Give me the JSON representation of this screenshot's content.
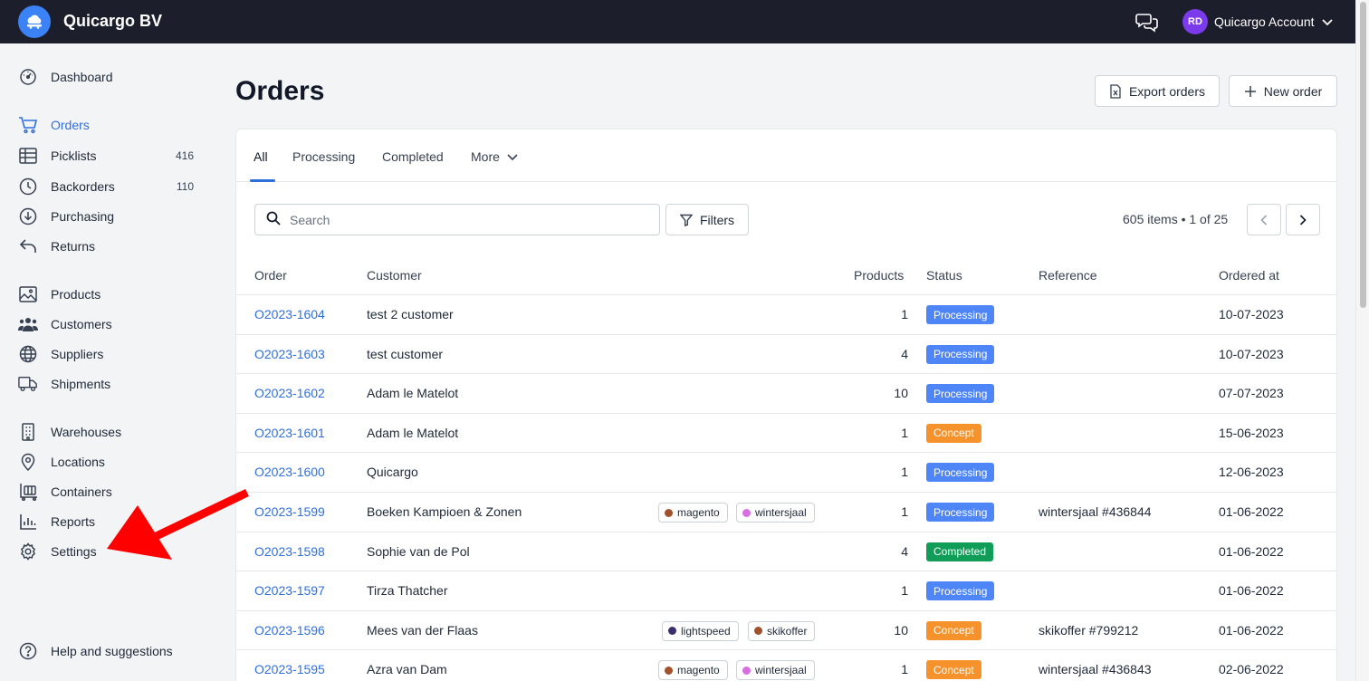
{
  "header": {
    "brand": "Quicargo BV",
    "account_initials": "RD",
    "account_name": "Quicargo Account",
    "colors": {
      "topbar": "#1c1f2b",
      "accent": "#2f6fdc",
      "avatar": "#7c3aed"
    }
  },
  "sidebar": {
    "items": [
      {
        "label": "Dashboard",
        "icon": "dashboard-icon",
        "count": ""
      },
      {
        "label": "Orders",
        "icon": "cart-icon",
        "count": "",
        "active": true
      },
      {
        "label": "Picklists",
        "icon": "table-icon",
        "count": "416"
      },
      {
        "label": "Backorders",
        "icon": "clock-icon",
        "count": "110"
      },
      {
        "label": "Purchasing",
        "icon": "download-circle-icon",
        "count": ""
      },
      {
        "label": "Returns",
        "icon": "return-icon",
        "count": ""
      },
      {
        "label": "Products",
        "icon": "image-icon",
        "count": ""
      },
      {
        "label": "Customers",
        "icon": "users-icon",
        "count": ""
      },
      {
        "label": "Suppliers",
        "icon": "globe-icon",
        "count": ""
      },
      {
        "label": "Shipments",
        "icon": "truck-icon",
        "count": ""
      },
      {
        "label": "Warehouses",
        "icon": "building-icon",
        "count": ""
      },
      {
        "label": "Locations",
        "icon": "map-pin-icon",
        "count": ""
      },
      {
        "label": "Containers",
        "icon": "container-icon",
        "count": ""
      },
      {
        "label": "Reports",
        "icon": "bar-chart-icon",
        "count": ""
      },
      {
        "label": "Settings",
        "icon": "gear-icon",
        "count": ""
      }
    ],
    "help": "Help and suggestions"
  },
  "main": {
    "title": "Orders",
    "export_label": "Export orders",
    "new_order_label": "New order",
    "tabs": [
      "All",
      "Processing",
      "Completed",
      "More"
    ],
    "search_placeholder": "Search",
    "filters_label": "Filters",
    "pager_info": "605 items • 1 of 25",
    "columns": [
      "Order",
      "Customer",
      "Products",
      "Status",
      "Reference",
      "Ordered at"
    ],
    "status_colors": {
      "Processing": "#4f86f7",
      "Concept": "#f5922c",
      "Completed": "#0f9d58"
    },
    "rows": [
      {
        "order": "O2023-1604",
        "customer": "test 2 customer",
        "tags": [],
        "products": "1",
        "status": "Processing",
        "reference": "",
        "ordered_at": "10-07-2023"
      },
      {
        "order": "O2023-1603",
        "customer": "test customer",
        "tags": [],
        "products": "4",
        "status": "Processing",
        "reference": "",
        "ordered_at": "10-07-2023"
      },
      {
        "order": "O2023-1602",
        "customer": "Adam le Matelot",
        "tags": [],
        "products": "10",
        "status": "Processing",
        "reference": "",
        "ordered_at": "07-07-2023"
      },
      {
        "order": "O2023-1601",
        "customer": "Adam le Matelot",
        "tags": [],
        "products": "1",
        "status": "Concept",
        "reference": "",
        "ordered_at": "15-06-2023"
      },
      {
        "order": "O2023-1600",
        "customer": "Quicargo",
        "tags": [],
        "products": "1",
        "status": "Processing",
        "reference": "",
        "ordered_at": "12-06-2023"
      },
      {
        "order": "O2023-1599",
        "customer": "Boeken Kampioen & Zonen",
        "tags": [
          {
            "label": "magento",
            "color": "#a0522d"
          },
          {
            "label": "wintersjaal",
            "color": "#d86ee0"
          }
        ],
        "products": "1",
        "status": "Processing",
        "reference": "wintersjaal #436844",
        "ordered_at": "01-06-2022"
      },
      {
        "order": "O2023-1598",
        "customer": "Sophie van de Pol",
        "tags": [],
        "products": "4",
        "status": "Completed",
        "reference": "",
        "ordered_at": "01-06-2022"
      },
      {
        "order": "O2023-1597",
        "customer": "Tirza Thatcher",
        "tags": [],
        "products": "1",
        "status": "Processing",
        "reference": "",
        "ordered_at": "01-06-2022"
      },
      {
        "order": "O2023-1596",
        "customer": "Mees van der Flaas",
        "tags": [
          {
            "label": "lightspeed",
            "color": "#3b2f6b"
          },
          {
            "label": "skikoffer",
            "color": "#a0522d"
          }
        ],
        "products": "10",
        "status": "Concept",
        "reference": "skikoffer #799212",
        "ordered_at": "01-06-2022"
      },
      {
        "order": "O2023-1595",
        "customer": "Azra van Dam",
        "tags": [
          {
            "label": "magento",
            "color": "#a0522d"
          },
          {
            "label": "wintersjaal",
            "color": "#d86ee0"
          }
        ],
        "products": "1",
        "status": "Concept",
        "reference": "wintersjaal #436843",
        "ordered_at": "02-06-2022"
      }
    ]
  },
  "annotation": {
    "arrow_color": "#ff0000",
    "points_to": "Settings"
  }
}
